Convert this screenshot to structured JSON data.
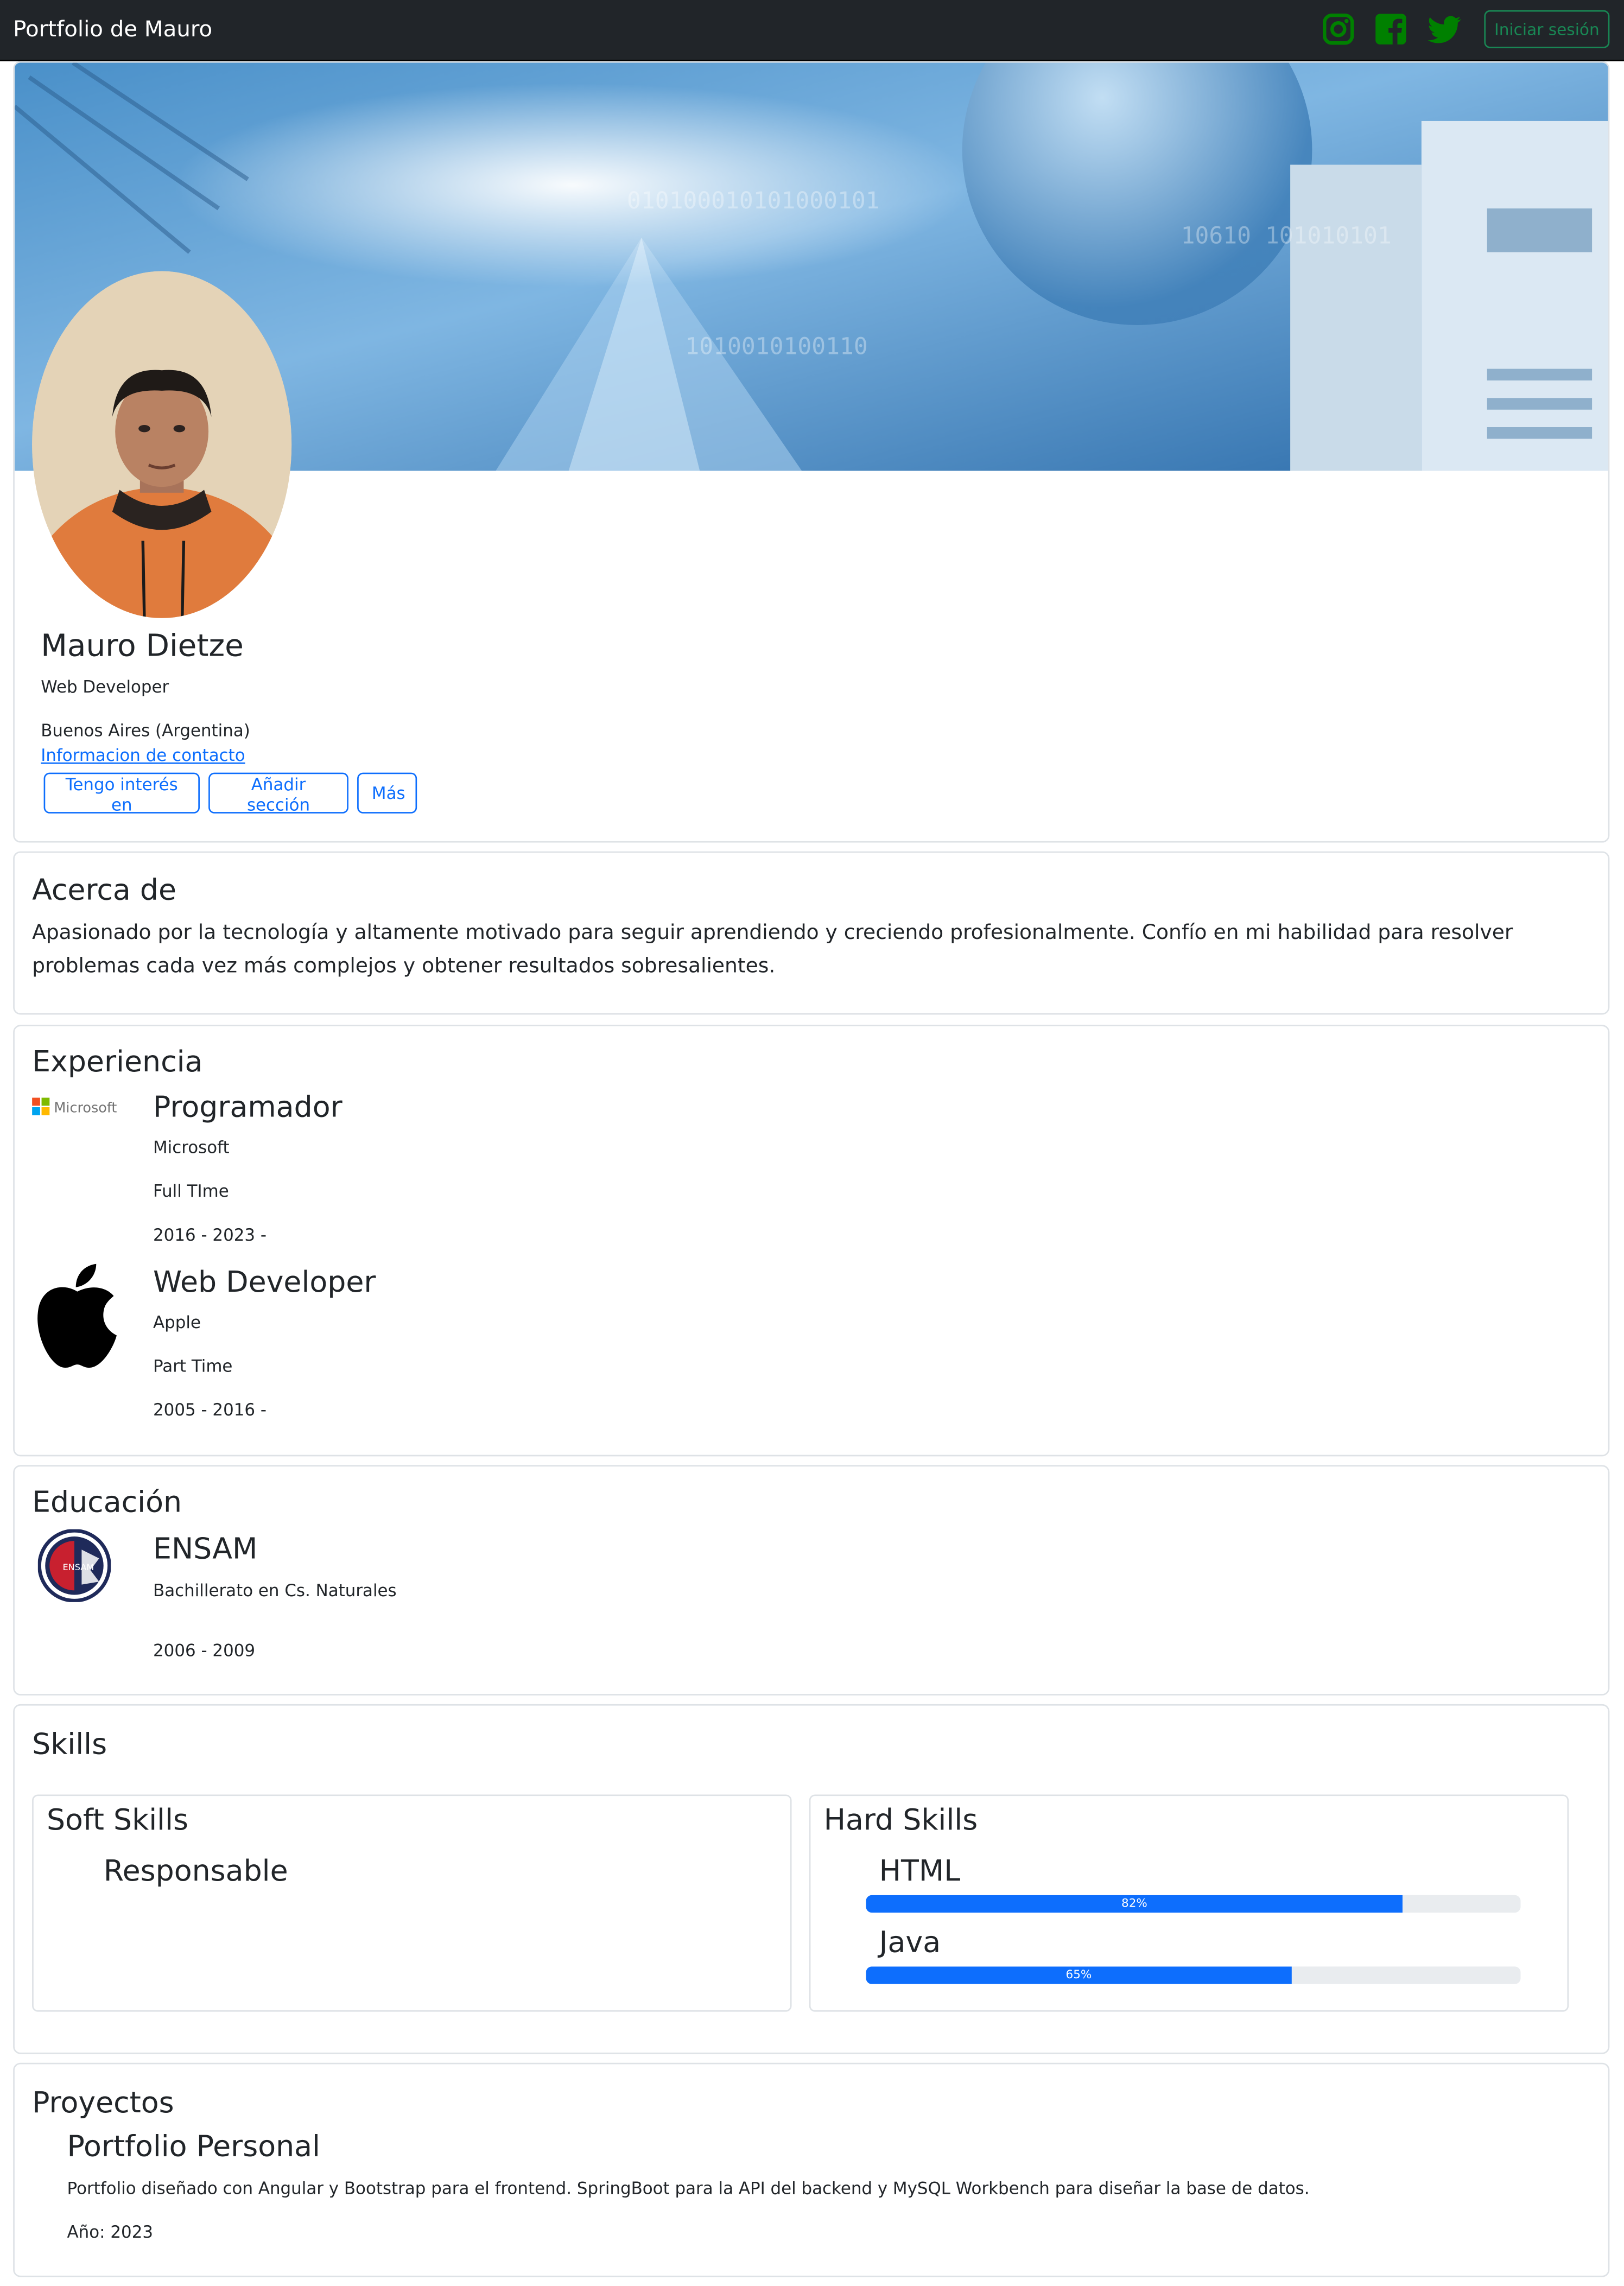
{
  "navbar": {
    "brand": "Portfolio de Mauro",
    "login_label": "Iniciar sesión",
    "social_icons": [
      "instagram-icon",
      "facebook-icon",
      "twitter-icon"
    ],
    "icon_color": "#008000",
    "login_color": "#198754"
  },
  "profile": {
    "name": "Mauro Dietze",
    "role": "Web Developer",
    "location": "Buenos Aires (Argentina)",
    "contact_link": "Informacion de contacto",
    "buttons": [
      "Tengo interés en",
      "Añadir sección",
      "Más"
    ]
  },
  "about": {
    "title": "Acerca de",
    "text": "Apasionado por la tecnología y altamente motivado para seguir aprendiendo y creciendo profesionalmente. Confío en mi habilidad para resolver problemas cada vez más complejos y obtener resultados sobresalientes."
  },
  "experience": {
    "title": "Experiencia",
    "items": [
      {
        "title": "Programador",
        "company": "Microsoft",
        "type": "Full TIme",
        "period": "2016 - 2023 -",
        "logo": "microsoft-logo",
        "logo_text": "Microsoft"
      },
      {
        "title": "Web Developer",
        "company": "Apple",
        "type": "Part Time",
        "period": "2005 - 2016 -",
        "logo": "apple-logo"
      }
    ]
  },
  "education": {
    "title": "Educación",
    "items": [
      {
        "school": "ENSAM",
        "degree": "Bachillerato en Cs. Naturales",
        "period": "2006 - 2009",
        "logo": "ensam-logo",
        "logo_text": "ENSAM"
      }
    ]
  },
  "skills": {
    "title": "Skills",
    "soft_title": "Soft Skills",
    "soft": [
      "Responsable"
    ],
    "hard_title": "Hard Skills",
    "hard": [
      {
        "name": "HTML",
        "percent": 82,
        "label": "82%"
      },
      {
        "name": "Java",
        "percent": 65,
        "label": "65%"
      }
    ]
  },
  "projects": {
    "title": "Proyectos",
    "items": [
      {
        "title": "Portfolio Personal",
        "description": "Portfolio diseñado con Angular y Bootstrap para el frontend. SpringBoot para la API del backend y MySQL Workbench para diseñar la base de datos.",
        "year": "Año: 2023"
      }
    ]
  }
}
